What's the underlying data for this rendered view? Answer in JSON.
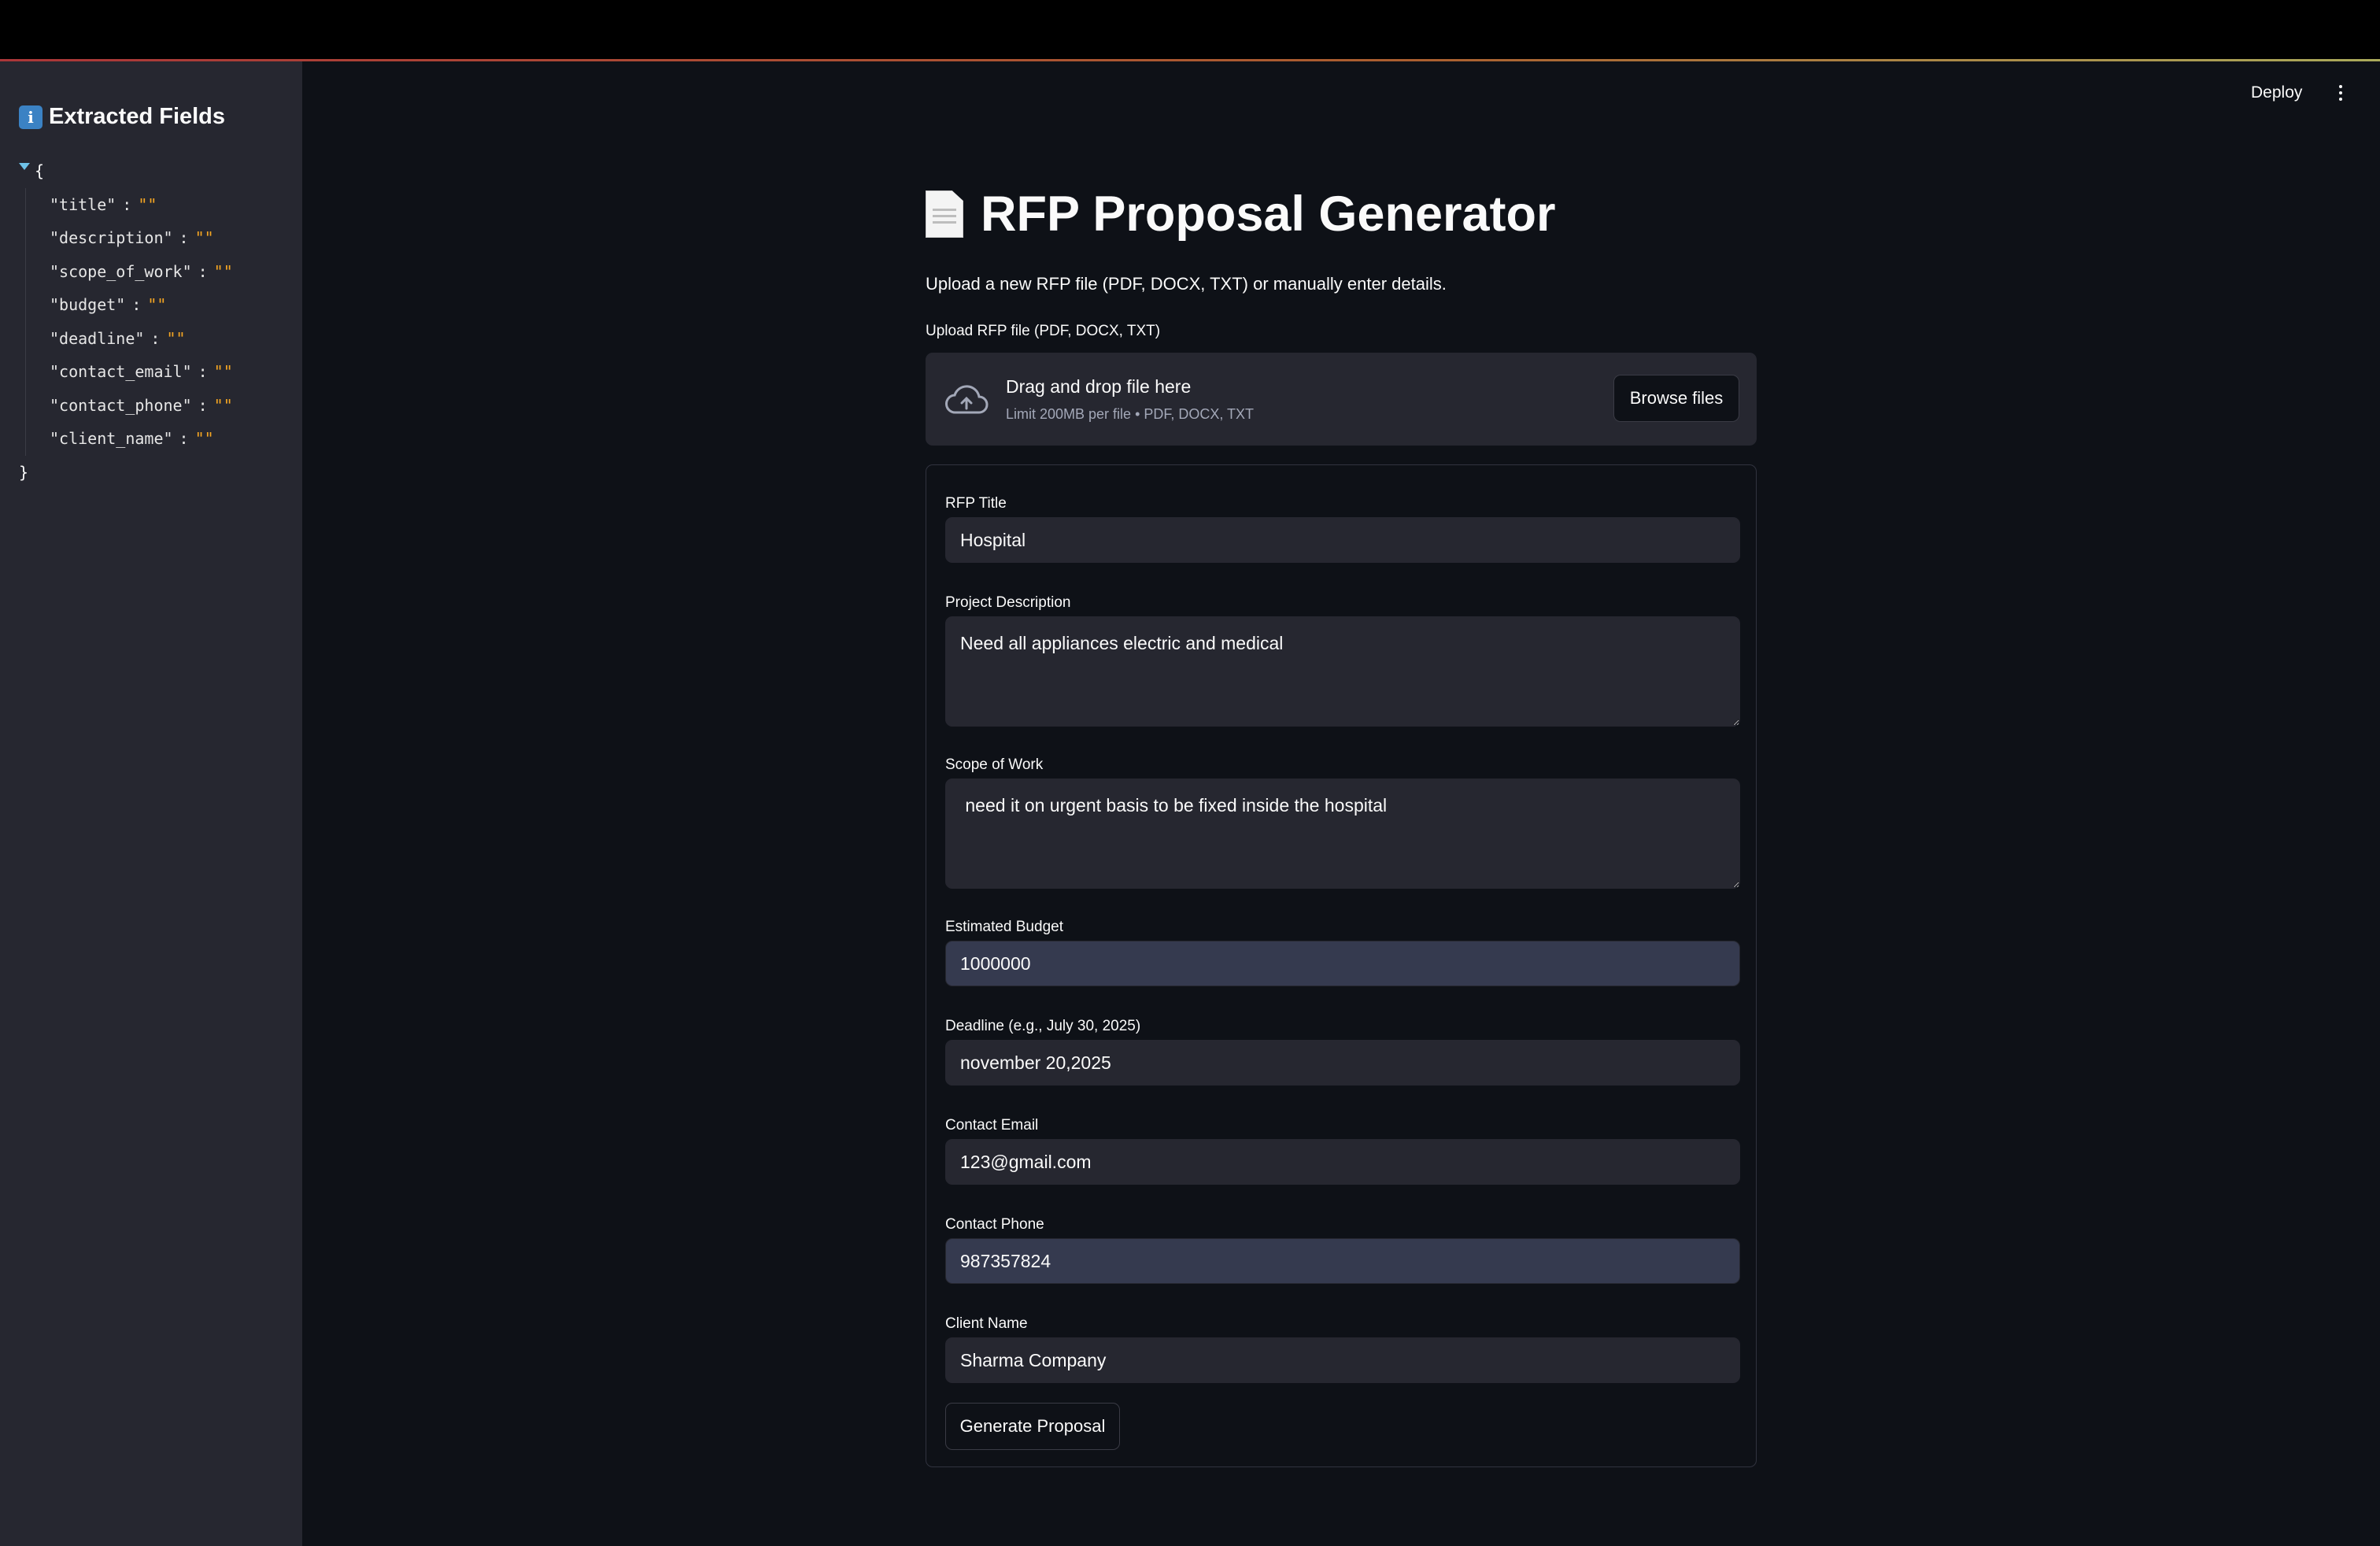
{
  "header": {
    "deploy_label": "Deploy",
    "menu_icon": "more-vertical-icon"
  },
  "sidebar": {
    "title": "Extracted Fields",
    "title_icon": "info-icon",
    "json_open": "{",
    "json_close": "}",
    "fields": [
      {
        "key": "\"title\"",
        "value": "\"\""
      },
      {
        "key": "\"description\"",
        "value": "\"\""
      },
      {
        "key": "\"scope_of_work\"",
        "value": "\"\""
      },
      {
        "key": "\"budget\"",
        "value": "\"\""
      },
      {
        "key": "\"deadline\"",
        "value": "\"\""
      },
      {
        "key": "\"contact_email\"",
        "value": "\"\""
      },
      {
        "key": "\"contact_phone\"",
        "value": "\"\""
      },
      {
        "key": "\"client_name\"",
        "value": "\"\""
      }
    ]
  },
  "main": {
    "title": "RFP Proposal Generator",
    "title_icon": "document-icon",
    "subtitle": "Upload a new RFP file (PDF, DOCX, TXT) or manually enter details.",
    "upload": {
      "label": "Upload RFP file (PDF, DOCX, TXT)",
      "drop_text": "Drag and drop file here",
      "limit_text": "Limit 200MB per file • PDF, DOCX, TXT",
      "browse_label": "Browse files",
      "icon": "cloud-upload-icon"
    },
    "form": {
      "rfp_title": {
        "label": "RFP Title",
        "value": "Hospital"
      },
      "description": {
        "label": "Project Description",
        "value": "Need all appliances electric and medical"
      },
      "scope": {
        "label": "Scope of Work",
        "value": " need it on urgent basis to be fixed inside the hospital"
      },
      "budget": {
        "label": "Estimated Budget",
        "value": "1000000"
      },
      "deadline": {
        "label": "Deadline (e.g., July 30, 2025)",
        "value": "november 20,2025"
      },
      "email": {
        "label": "Contact Email",
        "value": "123@gmail.com"
      },
      "phone": {
        "label": "Contact Phone",
        "value": "987357824"
      },
      "client": {
        "label": "Client Name",
        "value": "Sharma Company"
      },
      "submit_label": "Generate Proposal"
    }
  },
  "colors": {
    "app_bg": "#0e1117",
    "sidebar_bg": "#262730",
    "input_bg": "#262730",
    "json_value": "#f5a623"
  }
}
